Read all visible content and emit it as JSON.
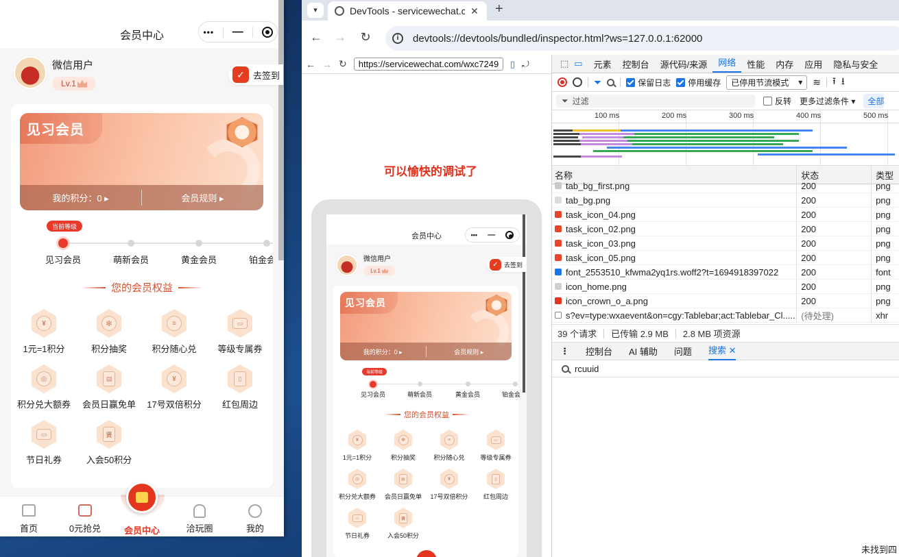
{
  "phone": {
    "nav_title": "会员中心",
    "capsule": {
      "more": "•••",
      "minimize": "—"
    },
    "user": {
      "name": "微信用户",
      "level": "Lv.1"
    },
    "signin_label": "去签到",
    "card": {
      "title": "见习会员",
      "points": "我的积分：0 ▸",
      "rules": "会员规则 ▸"
    },
    "current_tag": "当前等级",
    "levels": [
      "见习会员",
      "萌新会员",
      "黄金会员",
      "铂金会"
    ],
    "benefits_title": "您的会员权益",
    "benefits": [
      {
        "label": "1元=1积分",
        "icon": "coin-icon"
      },
      {
        "label": "积分抽奖",
        "icon": "lottery-icon"
      },
      {
        "label": "积分随心兑",
        "icon": "exchange-icon"
      },
      {
        "label": "等级专属券",
        "icon": "ticket-icon"
      },
      {
        "label": "积分兑大额券",
        "icon": "big-coupon-icon"
      },
      {
        "label": "会员日赢免单",
        "icon": "free-order-icon"
      },
      {
        "label": "17号双倍积分",
        "icon": "double-points-icon"
      },
      {
        "label": "红包周边",
        "icon": "red-packet-icon"
      },
      {
        "label": "节日礼券",
        "icon": "holiday-coupon-icon"
      },
      {
        "label": "入会50积分",
        "icon": "join-bonus-icon"
      }
    ],
    "tabs": [
      {
        "label": "首页",
        "icon": "home-icon"
      },
      {
        "label": "0元抢兑",
        "icon": "gift-icon"
      },
      {
        "label": "会员中心",
        "icon": "member-bag-icon",
        "active": true
      },
      {
        "label": "洽玩圈",
        "icon": "thumb-icon"
      },
      {
        "label": "我的",
        "icon": "profile-icon"
      }
    ],
    "active_color": "#e4351f"
  },
  "browser": {
    "tab_title": "DevTools - servicewechat.com",
    "new_tab": "+",
    "url": "devtools://devtools/bundled/inspector.html?ws=127.0.0.1:62000",
    "inner_url": "https://servicewechat.com/wxc7249",
    "banner_text": "可以愉快的调试了"
  },
  "sim": {
    "nav_title": "会员中心",
    "user_name": "微信用户",
    "level": "Lv.1",
    "signin_label": "去签到",
    "card_title": "见习会员",
    "points": "我的积分：0 ▸",
    "rules": "会员规则 ▸",
    "current_tag": "当前等级",
    "levels": [
      "见习会员",
      "萌新会员",
      "黄金会员",
      "铂金会"
    ],
    "benefits_title": "您的会员权益",
    "benefits": [
      "1元=1积分",
      "积分抽奖",
      "积分随心兑",
      "等级专属券",
      "积分兑大额券",
      "会员日赢免单",
      "17号双倍积分",
      "红包周边",
      "节日礼券",
      "入会50积分"
    ]
  },
  "devtools": {
    "tabs": [
      "元素",
      "控制台",
      "源代码/来源",
      "网络",
      "性能",
      "内存",
      "应用",
      "隐私与安全"
    ],
    "active_tab": "网络",
    "toolbar": {
      "preserve_log": "保留日志",
      "disable_cache": "停用缓存",
      "throttle": "已停用节流模式"
    },
    "filter": {
      "placeholder": "过滤",
      "invert": "反转",
      "more": "更多过滤条件 ▾",
      "all": "全部"
    },
    "timeline_ticks": [
      "100 ms",
      "200 ms",
      "300 ms",
      "400 ms",
      "500 ms"
    ],
    "columns": {
      "name": "名称",
      "status": "状态",
      "type": "类型"
    },
    "rows": [
      {
        "name": "tab_bg_first.png",
        "status": "200",
        "type": "png",
        "icon_color": "#c8c8c8"
      },
      {
        "name": "tab_bg.png",
        "status": "200",
        "type": "png",
        "icon_color": "#dcdcdc"
      },
      {
        "name": "task_icon_04.png",
        "status": "200",
        "type": "png",
        "icon_color": "#e8452c"
      },
      {
        "name": "task_icon_02.png",
        "status": "200",
        "type": "png",
        "icon_color": "#e8452c"
      },
      {
        "name": "task_icon_03.png",
        "status": "200",
        "type": "png",
        "icon_color": "#e8452c"
      },
      {
        "name": "task_icon_05.png",
        "status": "200",
        "type": "png",
        "icon_color": "#e8452c"
      },
      {
        "name": "font_2553510_kfwma2yq1rs.woff2?t=1694918397022",
        "status": "200",
        "type": "font",
        "icon_color": "#1a73e8"
      },
      {
        "name": "icon_home.png",
        "status": "200",
        "type": "png",
        "icon_color": "#d0d0d0"
      },
      {
        "name": "icon_crown_o_a.png",
        "status": "200",
        "type": "png",
        "icon_color": "#e4351f"
      },
      {
        "name": "s?ev=type:wxaevent&on=cgy:Tablebar;act:Tablebar_Cl......",
        "status": "(待处理)",
        "type": "xhr",
        "icon_color": "#ffffff"
      }
    ],
    "summary": {
      "requests": "39 个请求",
      "transferred": "已传输 2.9 MB",
      "resources": "2.8 MB 项资源"
    },
    "drawer_tabs": [
      "控制台",
      "AI 辅助",
      "问题",
      "搜索"
    ],
    "drawer_active": "搜索",
    "search_query": "rcuuid",
    "not_found": "未找到四"
  }
}
